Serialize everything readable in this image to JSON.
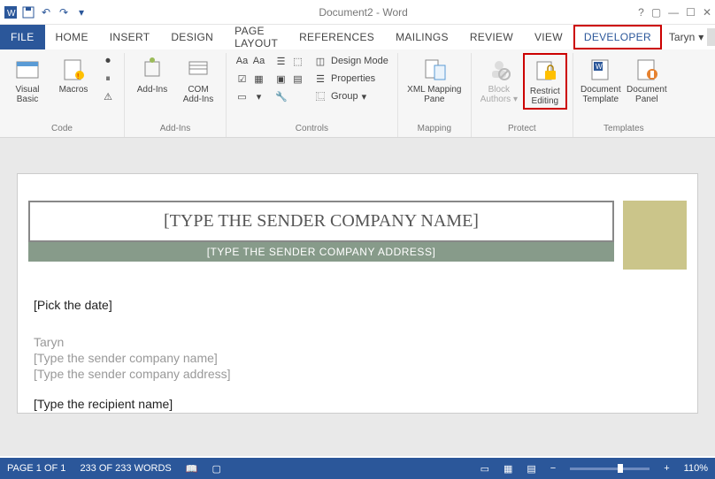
{
  "title": "Document2 - Word",
  "tabs": {
    "file": "FILE",
    "home": "HOME",
    "insert": "INSERT",
    "design": "DESIGN",
    "page_layout": "PAGE LAYOUT",
    "references": "REFERENCES",
    "mailings": "MAILINGS",
    "review": "REVIEW",
    "view": "VIEW",
    "developer": "DEVELOPER"
  },
  "user": "Taryn",
  "ribbon": {
    "code": {
      "label": "Code",
      "visual_basic": "Visual Basic",
      "macros": "Macros"
    },
    "addins": {
      "label": "Add-Ins",
      "addins": "Add-Ins",
      "com": "COM Add-Ins"
    },
    "controls": {
      "label": "Controls",
      "design_mode": "Design Mode",
      "properties": "Properties",
      "group": "Group"
    },
    "mapping": {
      "label": "Mapping",
      "xml_pane": "XML Mapping Pane"
    },
    "protect": {
      "label": "Protect",
      "block_authors": "Block Authors",
      "restrict": "Restrict Editing"
    },
    "templates": {
      "label": "Templates",
      "doc_template": "Document Template",
      "doc_panel": "Document Panel"
    }
  },
  "doc": {
    "title_ph": "[TYPE THE SENDER COMPANY NAME]",
    "addr_ph": "[TYPE THE SENDER COMPANY ADDRESS]",
    "date_ph": "[Pick the date]",
    "sender": "Taryn",
    "sender_company_ph": "[Type the sender company name]",
    "sender_addr_ph": "[Type the sender company address]",
    "recipient_ph": "[Type the recipient name]"
  },
  "status": {
    "page": "PAGE 1 OF 1",
    "words": "233 OF 233 WORDS",
    "zoom": "110%"
  }
}
